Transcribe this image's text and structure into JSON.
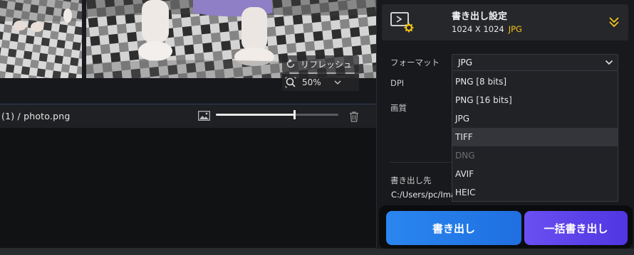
{
  "preview": {
    "refresh_label": "リフレッシュ",
    "zoom_value": "50%"
  },
  "filebar": {
    "path": "(1)  /   photo.png",
    "slider_fraction": 0.64
  },
  "export_header": {
    "title": "書き出し設定",
    "dimensions": "1024 X 1024",
    "format": "JPG"
  },
  "form": {
    "format_label": "フォーマット",
    "format_value": "JPG",
    "dpi_label": "DPI",
    "quality_label": "画質",
    "destination_label": "書き出し先",
    "destination_path": "C:/Users/pc/Imag"
  },
  "dropdown": {
    "options": [
      {
        "label": "PNG   [8 bits]",
        "state": "normal"
      },
      {
        "label": "PNG   [16 bits]",
        "state": "normal"
      },
      {
        "label": "JPG",
        "state": "normal"
      },
      {
        "label": "TIFF",
        "state": "hover"
      },
      {
        "label": "DNG",
        "state": "disabled"
      },
      {
        "label": "AVIF",
        "state": "normal"
      },
      {
        "label": "HEIC",
        "state": "normal"
      }
    ]
  },
  "buttons": {
    "export_label": "書き出し",
    "batch_export_label": "一括書き出し"
  },
  "colors": {
    "accent_yellow": "#f5c518",
    "export_blue": "#2a86f0",
    "batch_purple": "#6a4ff2"
  },
  "icons": {
    "export_settings": "monitor-gear-icon",
    "collapse": "double-chevron-down-icon",
    "refresh": "refresh-icon",
    "zoom": "magnifier-icon",
    "image": "image-icon",
    "trash": "trash-icon"
  }
}
